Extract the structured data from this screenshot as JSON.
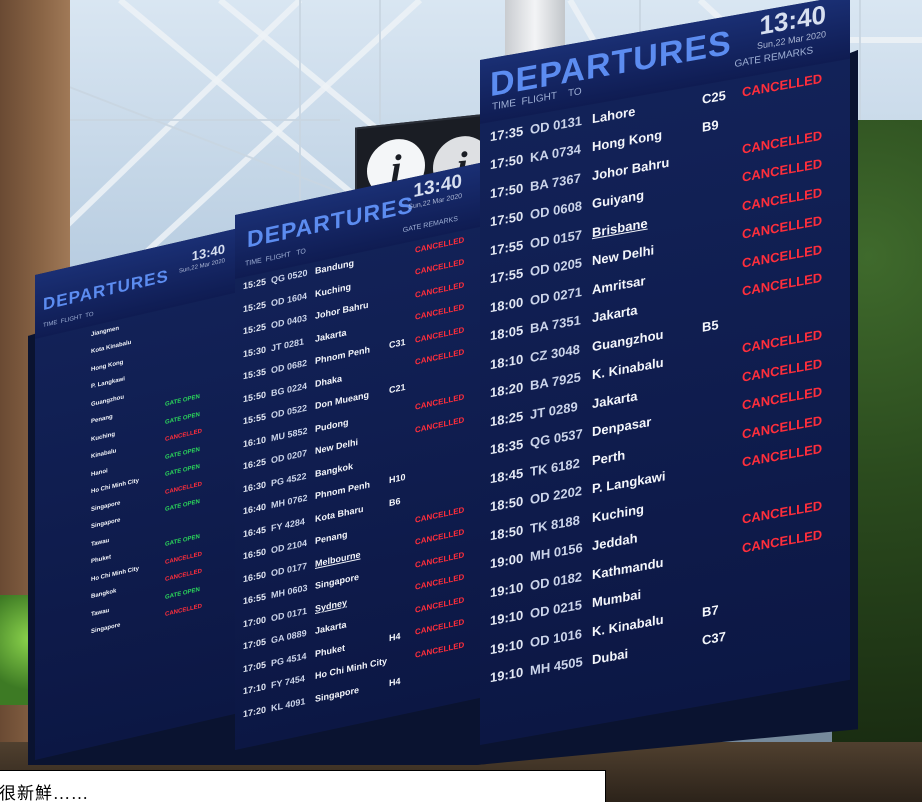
{
  "right_board": {
    "title": "DEPARTURES",
    "clock": "13:40",
    "date": "Sun,22 Mar 2020",
    "col_time": "TIME",
    "col_flight": "FLIGHT",
    "col_to": "TO",
    "col_gate_remarks": "GATE REMARKS",
    "rows": [
      {
        "time": "17:35",
        "flight": "OD 0131",
        "to": "Lahore",
        "gate": "C25",
        "remark": "CANCELLED"
      },
      {
        "time": "17:50",
        "flight": "KA 0734",
        "to": "Hong Kong",
        "gate": "B9",
        "remark": ""
      },
      {
        "time": "17:50",
        "flight": "BA 7367",
        "to": "Johor Bahru",
        "gate": "",
        "remark": "CANCELLED"
      },
      {
        "time": "17:50",
        "flight": "OD 0608",
        "to": "Guiyang",
        "gate": "",
        "remark": "CANCELLED"
      },
      {
        "time": "17:55",
        "flight": "OD 0157",
        "to": "Brisbane",
        "gate": "",
        "remark": "CANCELLED"
      },
      {
        "time": "17:55",
        "flight": "OD 0205",
        "to": "New Delhi",
        "gate": "",
        "remark": "CANCELLED"
      },
      {
        "time": "18:00",
        "flight": "OD 0271",
        "to": "Amritsar",
        "gate": "",
        "remark": "CANCELLED"
      },
      {
        "time": "18:05",
        "flight": "BA 7351",
        "to": "Jakarta",
        "gate": "",
        "remark": "CANCELLED"
      },
      {
        "time": "18:10",
        "flight": "CZ 3048",
        "to": "Guangzhou",
        "gate": "B5",
        "remark": ""
      },
      {
        "time": "18:20",
        "flight": "BA 7925",
        "to": "K. Kinabalu",
        "gate": "",
        "remark": "CANCELLED"
      },
      {
        "time": "18:25",
        "flight": "JT 0289",
        "to": "Jakarta",
        "gate": "",
        "remark": "CANCELLED"
      },
      {
        "time": "18:35",
        "flight": "QG 0537",
        "to": "Denpasar",
        "gate": "",
        "remark": "CANCELLED"
      },
      {
        "time": "18:45",
        "flight": "TK 6182",
        "to": "Perth",
        "gate": "",
        "remark": "CANCELLED"
      },
      {
        "time": "18:50",
        "flight": "OD 2202",
        "to": "P. Langkawi",
        "gate": "",
        "remark": "CANCELLED"
      },
      {
        "time": "18:50",
        "flight": "TK 8188",
        "to": "Kuching",
        "gate": "",
        "remark": ""
      },
      {
        "time": "19:00",
        "flight": "MH 0156",
        "to": "Jeddah",
        "gate": "",
        "remark": "CANCELLED"
      },
      {
        "time": "19:10",
        "flight": "OD 0182",
        "to": "Kathmandu",
        "gate": "",
        "remark": "CANCELLED"
      },
      {
        "time": "19:10",
        "flight": "OD 0215",
        "to": "Mumbai",
        "gate": "",
        "remark": ""
      },
      {
        "time": "19:10",
        "flight": "OD 1016",
        "to": "K. Kinabalu",
        "gate": "B7",
        "remark": ""
      },
      {
        "time": "19:10",
        "flight": "MH 4505",
        "to": "Dubai",
        "gate": "C37",
        "remark": ""
      }
    ]
  },
  "middle_board": {
    "title": "DEPARTURES",
    "clock": "13:40",
    "date": "Sun,22 Mar 2020",
    "col_time": "TIME",
    "col_flight": "FLIGHT",
    "col_to": "TO",
    "col_gate_remarks": "GATE REMARKS",
    "rows": [
      {
        "time": "15:25",
        "flight": "QG 0520",
        "to": "Bandung",
        "gate": "",
        "remark": "CANCELLED"
      },
      {
        "time": "15:25",
        "flight": "OD 1604",
        "to": "Kuching",
        "gate": "",
        "remark": "CANCELLED"
      },
      {
        "time": "15:25",
        "flight": "OD 0403",
        "to": "Johor Bahru",
        "gate": "",
        "remark": "CANCELLED"
      },
      {
        "time": "15:30",
        "flight": "JT 0281",
        "to": "Jakarta",
        "gate": "",
        "remark": "CANCELLED"
      },
      {
        "time": "15:35",
        "flight": "OD 0682",
        "to": "Phnom Penh",
        "gate": "C31",
        "remark": "CANCELLED"
      },
      {
        "time": "15:50",
        "flight": "BG 0224",
        "to": "Dhaka",
        "gate": "",
        "remark": "CANCELLED"
      },
      {
        "time": "15:55",
        "flight": "OD 0522",
        "to": "Don Mueang",
        "gate": "C21",
        "remark": ""
      },
      {
        "time": "16:10",
        "flight": "MU 5852",
        "to": "Pudong",
        "gate": "",
        "remark": "CANCELLED"
      },
      {
        "time": "16:25",
        "flight": "OD 0207",
        "to": "New Delhi",
        "gate": "",
        "remark": "CANCELLED"
      },
      {
        "time": "16:30",
        "flight": "PG 4522",
        "to": "Bangkok",
        "gate": "",
        "remark": ""
      },
      {
        "time": "16:40",
        "flight": "MH 0762",
        "to": "Phnom Penh",
        "gate": "H10",
        "remark": ""
      },
      {
        "time": "16:45",
        "flight": "FY 4284",
        "to": "Kota Bharu",
        "gate": "B6",
        "remark": ""
      },
      {
        "time": "16:50",
        "flight": "OD 2104",
        "to": "Penang",
        "gate": "",
        "remark": "CANCELLED"
      },
      {
        "time": "16:50",
        "flight": "OD 0177",
        "to": "Melbourne",
        "gate": "",
        "remark": "CANCELLED"
      },
      {
        "time": "16:55",
        "flight": "MH 0603",
        "to": "Singapore",
        "gate": "",
        "remark": "CANCELLED"
      },
      {
        "time": "17:00",
        "flight": "OD 0171",
        "to": "Sydney",
        "gate": "",
        "remark": "CANCELLED"
      },
      {
        "time": "17:05",
        "flight": "GA 0889",
        "to": "Jakarta",
        "gate": "",
        "remark": "CANCELLED"
      },
      {
        "time": "17:05",
        "flight": "PG 4514",
        "to": "Phuket",
        "gate": "H4",
        "remark": "CANCELLED"
      },
      {
        "time": "17:10",
        "flight": "FY 7454",
        "to": "Ho Chi Minh City",
        "gate": "",
        "remark": "CANCELLED"
      },
      {
        "time": "17:20",
        "flight": "KL 4091",
        "to": "Singapore",
        "gate": "H4",
        "remark": ""
      }
    ]
  },
  "left_board": {
    "title": "DEPARTURES",
    "clock": "13:40",
    "date": "Sun,22 Mar 2020",
    "col_time": "TIME",
    "col_flight": "FLIGHT",
    "col_to": "TO",
    "col_gate_remarks": "GATE REMARKS",
    "rows": [
      {
        "time": "",
        "flight": "",
        "to": "Jiangmen",
        "gate": "",
        "remark": "",
        "tone": "red"
      },
      {
        "time": "",
        "flight": "",
        "to": "Kota Kinabalu",
        "gate": "",
        "remark": "",
        "tone": "green"
      },
      {
        "time": "",
        "flight": "",
        "to": "Hong Kong",
        "gate": "",
        "remark": "",
        "tone": "green"
      },
      {
        "time": "",
        "flight": "",
        "to": "P. Langkawi",
        "gate": "",
        "remark": "",
        "tone": "red"
      },
      {
        "time": "",
        "flight": "",
        "to": "Guangzhou",
        "gate": "",
        "remark": "",
        "tone": "red"
      },
      {
        "time": "",
        "flight": "",
        "to": "Penang",
        "gate": "",
        "remark": "GATE OPEN",
        "tone": "green"
      },
      {
        "time": "",
        "flight": "",
        "to": "Kuching",
        "gate": "",
        "remark": "GATE OPEN",
        "tone": "green"
      },
      {
        "time": "",
        "flight": "",
        "to": "Kinabalu",
        "gate": "",
        "remark": "CANCELLED",
        "tone": "red"
      },
      {
        "time": "",
        "flight": "",
        "to": "Hanoi",
        "gate": "",
        "remark": "GATE OPEN",
        "tone": "green"
      },
      {
        "time": "",
        "flight": "",
        "to": "Ho Chi Minh City",
        "gate": "",
        "remark": "GATE OPEN",
        "tone": "green"
      },
      {
        "time": "",
        "flight": "",
        "to": "Singapore",
        "gate": "",
        "remark": "CANCELLED",
        "tone": "red"
      },
      {
        "time": "",
        "flight": "",
        "to": "Singapore",
        "gate": "",
        "remark": "GATE OPEN",
        "tone": "green"
      },
      {
        "time": "",
        "flight": "",
        "to": "Tawau",
        "gate": "",
        "remark": "",
        "tone": "red"
      },
      {
        "time": "",
        "flight": "",
        "to": "Phuket",
        "gate": "",
        "remark": "GATE OPEN",
        "tone": "green"
      },
      {
        "time": "",
        "flight": "",
        "to": "Ho Chi Minh City",
        "gate": "",
        "remark": "CANCELLED",
        "tone": "red"
      },
      {
        "time": "",
        "flight": "",
        "to": "Bangkok",
        "gate": "",
        "remark": "CANCELLED",
        "tone": "red"
      },
      {
        "time": "",
        "flight": "",
        "to": "Tawau",
        "gate": "",
        "remark": "GATE OPEN",
        "tone": "green"
      },
      {
        "time": "",
        "flight": "",
        "to": "Singapore",
        "gate": "",
        "remark": "CANCELLED",
        "tone": "red"
      }
    ]
  },
  "info_sign": {
    "glyph": "i",
    "icon": "info-icon"
  },
  "caption": {
    "text": "很新鮮……"
  },
  "colors": {
    "cancelled": "#ff2e3b",
    "gate_open": "#2bd45a",
    "title": "#5c8cf0",
    "board": "#0c1744"
  }
}
